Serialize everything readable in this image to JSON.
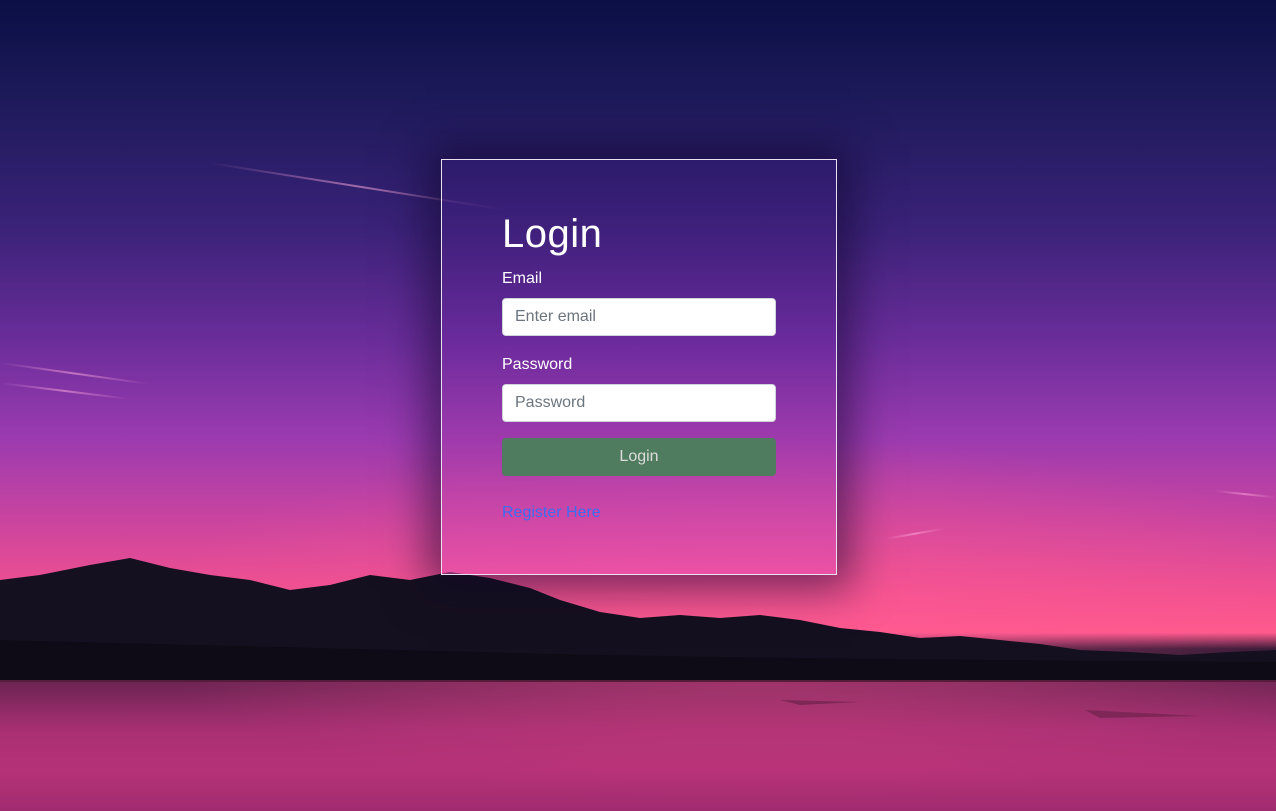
{
  "login_form": {
    "title": "Login",
    "email": {
      "label": "Email",
      "placeholder": "Enter email",
      "value": ""
    },
    "password": {
      "label": "Password",
      "placeholder": "Password",
      "value": ""
    },
    "submit_label": "Login",
    "register_link": "Register Here"
  },
  "colors": {
    "button_background": "#4f7c5f",
    "link": "#3c6cf0",
    "card_border": "#e9e0f0"
  }
}
